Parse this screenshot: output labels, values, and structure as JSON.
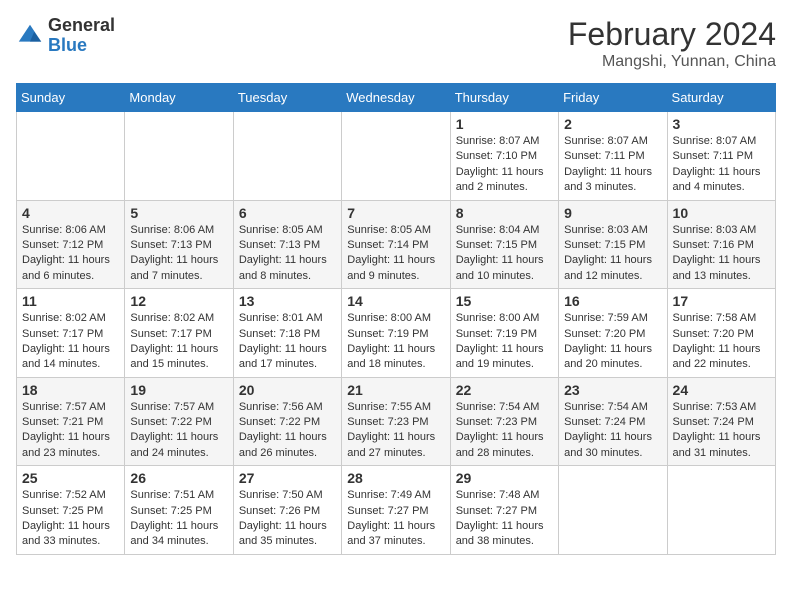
{
  "header": {
    "logo_general": "General",
    "logo_blue": "Blue",
    "month_year": "February 2024",
    "location": "Mangshi, Yunnan, China"
  },
  "days_of_week": [
    "Sunday",
    "Monday",
    "Tuesday",
    "Wednesday",
    "Thursday",
    "Friday",
    "Saturday"
  ],
  "weeks": [
    [
      {
        "day": "",
        "info": ""
      },
      {
        "day": "",
        "info": ""
      },
      {
        "day": "",
        "info": ""
      },
      {
        "day": "",
        "info": ""
      },
      {
        "day": "1",
        "info": "Sunrise: 8:07 AM\nSunset: 7:10 PM\nDaylight: 11 hours and 2 minutes."
      },
      {
        "day": "2",
        "info": "Sunrise: 8:07 AM\nSunset: 7:11 PM\nDaylight: 11 hours and 3 minutes."
      },
      {
        "day": "3",
        "info": "Sunrise: 8:07 AM\nSunset: 7:11 PM\nDaylight: 11 hours and 4 minutes."
      }
    ],
    [
      {
        "day": "4",
        "info": "Sunrise: 8:06 AM\nSunset: 7:12 PM\nDaylight: 11 hours and 6 minutes."
      },
      {
        "day": "5",
        "info": "Sunrise: 8:06 AM\nSunset: 7:13 PM\nDaylight: 11 hours and 7 minutes."
      },
      {
        "day": "6",
        "info": "Sunrise: 8:05 AM\nSunset: 7:13 PM\nDaylight: 11 hours and 8 minutes."
      },
      {
        "day": "7",
        "info": "Sunrise: 8:05 AM\nSunset: 7:14 PM\nDaylight: 11 hours and 9 minutes."
      },
      {
        "day": "8",
        "info": "Sunrise: 8:04 AM\nSunset: 7:15 PM\nDaylight: 11 hours and 10 minutes."
      },
      {
        "day": "9",
        "info": "Sunrise: 8:03 AM\nSunset: 7:15 PM\nDaylight: 11 hours and 12 minutes."
      },
      {
        "day": "10",
        "info": "Sunrise: 8:03 AM\nSunset: 7:16 PM\nDaylight: 11 hours and 13 minutes."
      }
    ],
    [
      {
        "day": "11",
        "info": "Sunrise: 8:02 AM\nSunset: 7:17 PM\nDaylight: 11 hours and 14 minutes."
      },
      {
        "day": "12",
        "info": "Sunrise: 8:02 AM\nSunset: 7:17 PM\nDaylight: 11 hours and 15 minutes."
      },
      {
        "day": "13",
        "info": "Sunrise: 8:01 AM\nSunset: 7:18 PM\nDaylight: 11 hours and 17 minutes."
      },
      {
        "day": "14",
        "info": "Sunrise: 8:00 AM\nSunset: 7:19 PM\nDaylight: 11 hours and 18 minutes."
      },
      {
        "day": "15",
        "info": "Sunrise: 8:00 AM\nSunset: 7:19 PM\nDaylight: 11 hours and 19 minutes."
      },
      {
        "day": "16",
        "info": "Sunrise: 7:59 AM\nSunset: 7:20 PM\nDaylight: 11 hours and 20 minutes."
      },
      {
        "day": "17",
        "info": "Sunrise: 7:58 AM\nSunset: 7:20 PM\nDaylight: 11 hours and 22 minutes."
      }
    ],
    [
      {
        "day": "18",
        "info": "Sunrise: 7:57 AM\nSunset: 7:21 PM\nDaylight: 11 hours and 23 minutes."
      },
      {
        "day": "19",
        "info": "Sunrise: 7:57 AM\nSunset: 7:22 PM\nDaylight: 11 hours and 24 minutes."
      },
      {
        "day": "20",
        "info": "Sunrise: 7:56 AM\nSunset: 7:22 PM\nDaylight: 11 hours and 26 minutes."
      },
      {
        "day": "21",
        "info": "Sunrise: 7:55 AM\nSunset: 7:23 PM\nDaylight: 11 hours and 27 minutes."
      },
      {
        "day": "22",
        "info": "Sunrise: 7:54 AM\nSunset: 7:23 PM\nDaylight: 11 hours and 28 minutes."
      },
      {
        "day": "23",
        "info": "Sunrise: 7:54 AM\nSunset: 7:24 PM\nDaylight: 11 hours and 30 minutes."
      },
      {
        "day": "24",
        "info": "Sunrise: 7:53 AM\nSunset: 7:24 PM\nDaylight: 11 hours and 31 minutes."
      }
    ],
    [
      {
        "day": "25",
        "info": "Sunrise: 7:52 AM\nSunset: 7:25 PM\nDaylight: 11 hours and 33 minutes."
      },
      {
        "day": "26",
        "info": "Sunrise: 7:51 AM\nSunset: 7:25 PM\nDaylight: 11 hours and 34 minutes."
      },
      {
        "day": "27",
        "info": "Sunrise: 7:50 AM\nSunset: 7:26 PM\nDaylight: 11 hours and 35 minutes."
      },
      {
        "day": "28",
        "info": "Sunrise: 7:49 AM\nSunset: 7:27 PM\nDaylight: 11 hours and 37 minutes."
      },
      {
        "day": "29",
        "info": "Sunrise: 7:48 AM\nSunset: 7:27 PM\nDaylight: 11 hours and 38 minutes."
      },
      {
        "day": "",
        "info": ""
      },
      {
        "day": "",
        "info": ""
      }
    ]
  ]
}
